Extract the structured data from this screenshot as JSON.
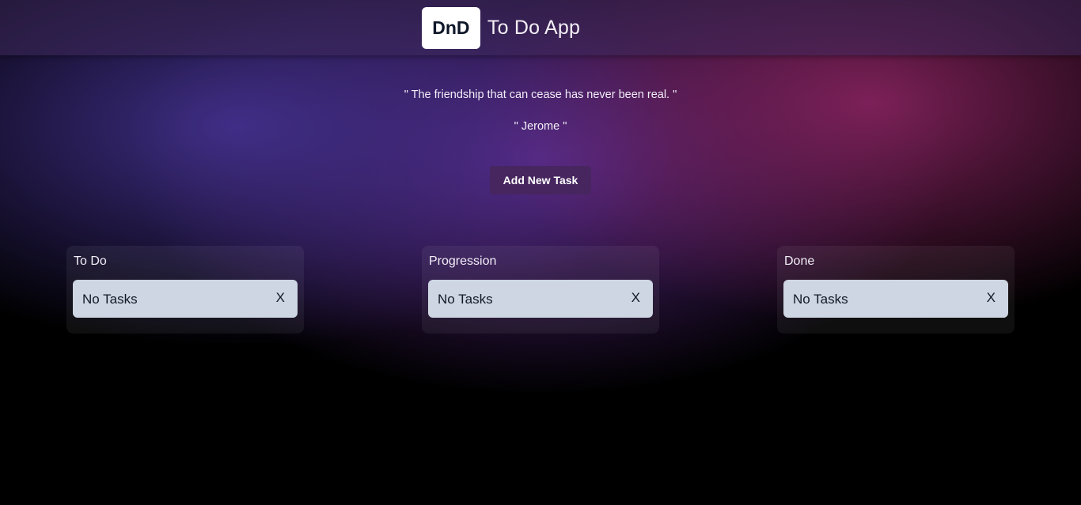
{
  "header": {
    "logo_text": "DnD",
    "app_title": "To Do App"
  },
  "quote": {
    "text": "\" The friendship that can cease has never been real. \"",
    "author": "\" Jerome \""
  },
  "actions": {
    "add_task_label": "Add New Task"
  },
  "columns": [
    {
      "title": "To Do",
      "tasks": [
        {
          "text": "No Tasks",
          "close_label": "X"
        }
      ]
    },
    {
      "title": "Progression",
      "tasks": [
        {
          "text": "No Tasks",
          "close_label": "X"
        }
      ]
    },
    {
      "title": "Done",
      "tasks": [
        {
          "text": "No Tasks",
          "close_label": "X"
        }
      ]
    }
  ],
  "colors": {
    "logo_bg": "#ffffff",
    "button_bg": "#472660",
    "card_bg": "#cdd6e2"
  }
}
